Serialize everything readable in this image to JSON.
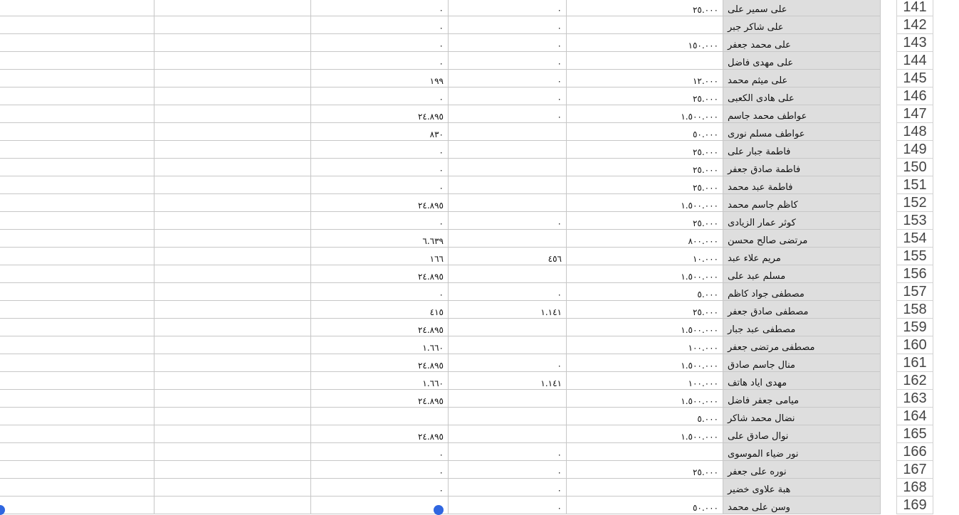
{
  "rows": [
    {
      "num": "141",
      "name": "على سمير على",
      "a": "٢٥.٠٠٠",
      "b": "٠",
      "c": "٠"
    },
    {
      "num": "142",
      "name": "على شاكر جبر",
      "a": "",
      "b": "٠",
      "c": "٠"
    },
    {
      "num": "143",
      "name": "على محمد جعفر",
      "a": "١٥٠.٠٠٠",
      "b": "٠",
      "c": "٠"
    },
    {
      "num": "144",
      "name": "على مهدى فاضل",
      "a": "",
      "b": "٠",
      "c": "٠"
    },
    {
      "num": "145",
      "name": "على ميثم محمد",
      "a": "١٢.٠٠٠",
      "b": "٠",
      "c": "١٩٩"
    },
    {
      "num": "146",
      "name": "على هادى الكعبى",
      "a": "٢٥.٠٠٠",
      "b": "٠",
      "c": "٠"
    },
    {
      "num": "147",
      "name": "عواطف محمد جاسم",
      "a": "١.٥٠٠.٠٠٠",
      "b": "٠",
      "c": "٢٤.٨٩٥"
    },
    {
      "num": "148",
      "name": "عواطف مسلم نورى",
      "a": "٥٠.٠٠٠",
      "b": "",
      "c": "٨٣٠"
    },
    {
      "num": "149",
      "name": "فاطمة جبار على",
      "a": "٢٥.٠٠٠",
      "b": "",
      "c": "٠"
    },
    {
      "num": "150",
      "name": "فاطمة صادق جعفر",
      "a": "٢٥.٠٠٠",
      "b": "",
      "c": "٠"
    },
    {
      "num": "151",
      "name": "فاطمة عبد محمد",
      "a": "٢٥.٠٠٠",
      "b": "",
      "c": "٠"
    },
    {
      "num": "152",
      "name": "كاظم جاسم محمد",
      "a": "١.٥٠٠.٠٠٠",
      "b": "",
      "c": "٢٤.٨٩٥"
    },
    {
      "num": "153",
      "name": "كوثر عمار الزيادى",
      "a": "٢٥.٠٠٠",
      "b": "٠",
      "c": "٠"
    },
    {
      "num": "154",
      "name": "مرتضى صالح محسن",
      "a": "٨٠٠.٠٠٠",
      "b": "",
      "c": "٦.٦٣٩"
    },
    {
      "num": "155",
      "name": "مريم علاء عبد",
      "a": "١٠.٠٠٠",
      "b": "٤٥٦",
      "c": "١٦٦"
    },
    {
      "num": "156",
      "name": "مسلم عبد على",
      "a": "١.٥٠٠.٠٠٠",
      "b": "",
      "c": "٢٤.٨٩٥"
    },
    {
      "num": "157",
      "name": "مصطفى جواد كاظم",
      "a": "٥.٠٠٠",
      "b": "٠",
      "c": "٠"
    },
    {
      "num": "158",
      "name": "مصطفى صادق جعفر",
      "a": "٢٥.٠٠٠",
      "b": "١.١٤١",
      "c": "٤١٥"
    },
    {
      "num": "159",
      "name": "مصطفى عبد جبار",
      "a": "١.٥٠٠.٠٠٠",
      "b": "",
      "c": "٢٤.٨٩٥"
    },
    {
      "num": "160",
      "name": "مصطفى مرتضى جعفر",
      "a": "١٠٠.٠٠٠",
      "b": "",
      "c": "١.٦٦٠"
    },
    {
      "num": "161",
      "name": "منال جاسم صادق",
      "a": "١.٥٠٠.٠٠٠",
      "b": "٠",
      "c": "٢٤.٨٩٥"
    },
    {
      "num": "162",
      "name": "مهدى اياد هاتف",
      "a": "١٠٠.٠٠٠",
      "b": "١.١٤١",
      "c": "١.٦٦٠"
    },
    {
      "num": "163",
      "name": "ميامى جعفر فاضل",
      "a": "١.٥٠٠.٠٠٠",
      "b": "",
      "c": "٢٤.٨٩٥"
    },
    {
      "num": "164",
      "name": "نضال محمد شاكر",
      "a": "٥.٠٠٠",
      "b": "",
      "c": ""
    },
    {
      "num": "165",
      "name": "نوال صادق على",
      "a": "١.٥٠٠.٠٠٠",
      "b": "",
      "c": "٢٤.٨٩٥"
    },
    {
      "num": "166",
      "name": "نور ضياء الموسوى",
      "a": "",
      "b": "٠",
      "c": "٠"
    },
    {
      "num": "167",
      "name": "نوره على جعفر",
      "a": "٢٥.٠٠٠",
      "b": "٠",
      "c": "٠"
    },
    {
      "num": "168",
      "name": "هبة علاوى خضير",
      "a": "",
      "b": "٠",
      "c": "٠"
    },
    {
      "num": "169",
      "name": "وسن على محمد",
      "a": "٥٠.٠٠٠",
      "b": "٠",
      "c": "٠"
    }
  ],
  "colors": {
    "name_column_bg": "#dedede",
    "selection_handle": "#2f66e0",
    "gridline": "#c7c7c7"
  }
}
